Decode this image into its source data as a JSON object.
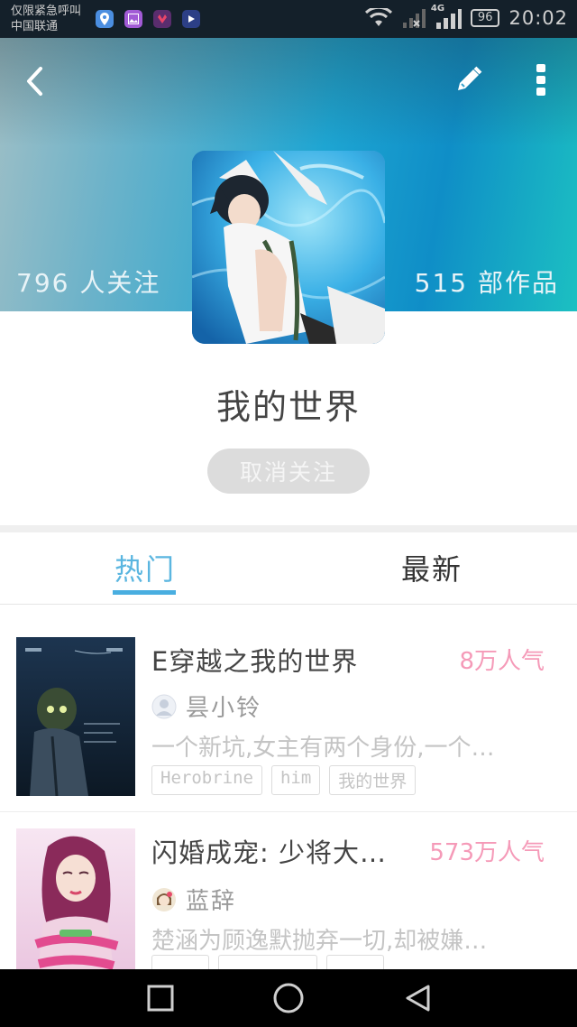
{
  "status_bar": {
    "carrier_line1": "仅限紧急呼叫",
    "carrier_line2": "中国联通",
    "network": "4G",
    "battery": "96",
    "time": "20:02"
  },
  "header": {
    "followers": "796 人关注",
    "works": "515 部作品"
  },
  "profile": {
    "title": "我的世界",
    "unfollow_label": "取消关注"
  },
  "tabs": [
    {
      "label": "热门",
      "active": true
    },
    {
      "label": "最新",
      "active": false
    }
  ],
  "books": [
    {
      "title": "E穿越之我的世界",
      "popularity": "8万人气",
      "author": "昙小铃",
      "description": "一个新坑,女主有两个身份,一个…",
      "tags": [
        "Herobrine",
        "him",
        "我的世界"
      ]
    },
    {
      "title": "闪婚成宠: 少将大…",
      "popularity": "573万人气",
      "author": "蓝辞",
      "description": "楚涵为顾逸默抛弃一切,却被嫌…",
      "tags": []
    }
  ],
  "colors": {
    "accent": "#49aee0",
    "popularity": "#f59ab8",
    "banner_start": "#6fb3c9",
    "banner_end": "#1cc0c2"
  },
  "icons": {
    "back": "back-chevron-icon",
    "edit": "pencil-icon",
    "more": "more-vertical-icon",
    "nav_recent": "square-icon",
    "nav_home": "circle-icon",
    "nav_back": "triangle-back-icon"
  }
}
